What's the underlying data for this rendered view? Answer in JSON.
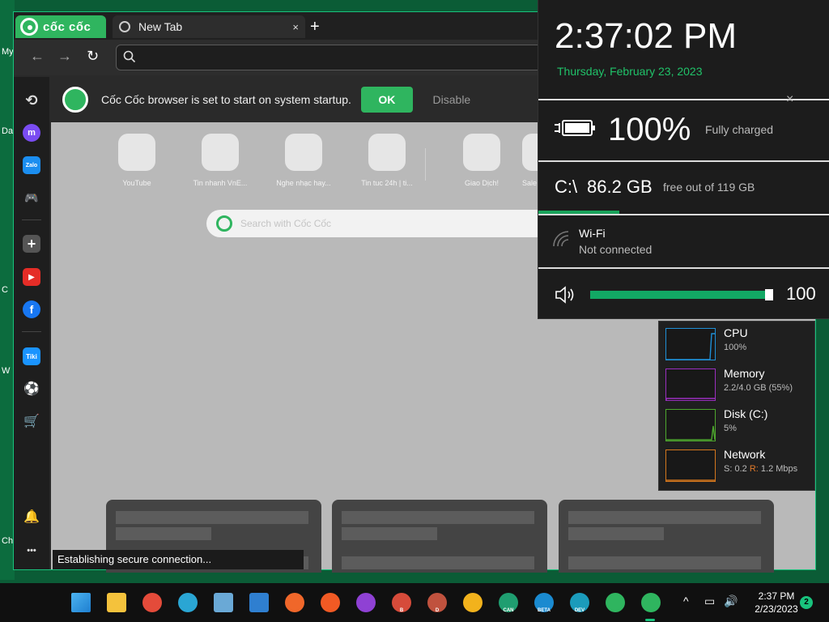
{
  "desktop": {
    "labels": [
      "My",
      "Da",
      "C",
      "W",
      "Ch"
    ]
  },
  "browser": {
    "brand": "cốc cốc",
    "tab_title": "New Tab",
    "tab_close": "×",
    "new_tab": "+",
    "address_value": "",
    "notification": {
      "text": "Cốc Cốc browser is set to start on system startup.",
      "ok_label": "OK",
      "disable_label": "Disable"
    },
    "sidebar": [
      {
        "name": "history-icon",
        "glyph": "⟲"
      },
      {
        "name": "messenger-icon",
        "glyph": "m"
      },
      {
        "name": "zalo-icon",
        "glyph": "Zalo"
      },
      {
        "name": "game-icon",
        "glyph": "🎮"
      },
      {
        "name": "add-icon",
        "glyph": "+"
      },
      {
        "name": "youtube-icon",
        "glyph": "▶"
      },
      {
        "name": "facebook-icon",
        "glyph": "f"
      },
      {
        "name": "tiki-icon",
        "glyph": "Tiki"
      },
      {
        "name": "football-icon",
        "glyph": "⚽"
      },
      {
        "name": "shopping-icon",
        "glyph": "🛒"
      },
      {
        "name": "bell-icon",
        "glyph": "🔔"
      },
      {
        "name": "more-icon",
        "glyph": "•••"
      }
    ],
    "tiles": [
      {
        "label": "YouTube"
      },
      {
        "label": "Tin nhanh VnE..."
      },
      {
        "label": "Nghe nhạc hay..."
      },
      {
        "label": "Tin tuc 24h | ti..."
      },
      {
        "label": "Giao Dịch!"
      },
      {
        "label": "Sale"
      }
    ],
    "search_placeholder": "Search with Cốc Cốc",
    "status_text": "Establishing secure connection..."
  },
  "flyout": {
    "time": "2:37:02 PM",
    "date": "Thursday, February 23, 2023",
    "close": "×",
    "battery": {
      "value": "100%",
      "label": "Fully charged"
    },
    "drive": {
      "letter": "C:\\",
      "free": "86.2 GB",
      "label": "free out of 119 GB"
    },
    "wifi": {
      "name": "Wi-Fi",
      "state": "Not connected"
    },
    "volume": {
      "value": "100",
      "level_percent": 100
    }
  },
  "performance": [
    {
      "name": "CPU",
      "value": "100%",
      "color": "#1f8fd6"
    },
    {
      "name": "Memory",
      "value": "2.2/4.0 GB (55%)",
      "color": "#9a2fc0"
    },
    {
      "name": "Disk (C:)",
      "value": "5%",
      "color": "#4ea72e"
    },
    {
      "name": "Network",
      "value_s_label": "S:",
      "value_s": "0.2",
      "value_r_label": "R:",
      "value_r": "1.2 Mbps",
      "color": "#d4771d"
    }
  ],
  "taskbar": {
    "time": "2:37 PM",
    "date": "2/23/2023",
    "notification_count": "2",
    "apps": [
      {
        "name": "windows-start-icon",
        "label": "",
        "color": "#4cb3f0"
      },
      {
        "name": "file-explorer-icon",
        "label": "",
        "color": "#f4c23c"
      },
      {
        "name": "chrome-icon",
        "label": "",
        "color": "#e44b3a"
      },
      {
        "name": "edge-icon",
        "label": "",
        "color": "#2aa6d4"
      },
      {
        "name": "photos-icon",
        "label": "",
        "color": "#6aa9d6"
      },
      {
        "name": "media-icon",
        "label": "",
        "color": "#2f7fd0"
      },
      {
        "name": "firefox-icon",
        "label": "",
        "color": "#f0672a"
      },
      {
        "name": "brave-icon",
        "label": "",
        "color": "#f15a24"
      },
      {
        "name": "game-bar-icon",
        "label": "",
        "color": "#8f41d4"
      },
      {
        "name": "chrome-beta-icon",
        "label": "B",
        "color": "#d64b3a"
      },
      {
        "name": "chrome-dev-icon",
        "label": "D",
        "color": "#c0523e"
      },
      {
        "name": "chrome-canary-icon",
        "label": "",
        "color": "#f2b21c"
      },
      {
        "name": "edge-canary-icon",
        "label": "CAN",
        "color": "#1f9e70"
      },
      {
        "name": "edge-beta-icon",
        "label": "BETA",
        "color": "#1a8ad0"
      },
      {
        "name": "edge-dev-icon",
        "label": "DEV",
        "color": "#1b9bbb"
      },
      {
        "name": "coccoc-alt-icon",
        "label": "",
        "color": "#2fb55f"
      },
      {
        "name": "coccoc-icon",
        "label": "",
        "color": "#2fb55f"
      }
    ]
  }
}
